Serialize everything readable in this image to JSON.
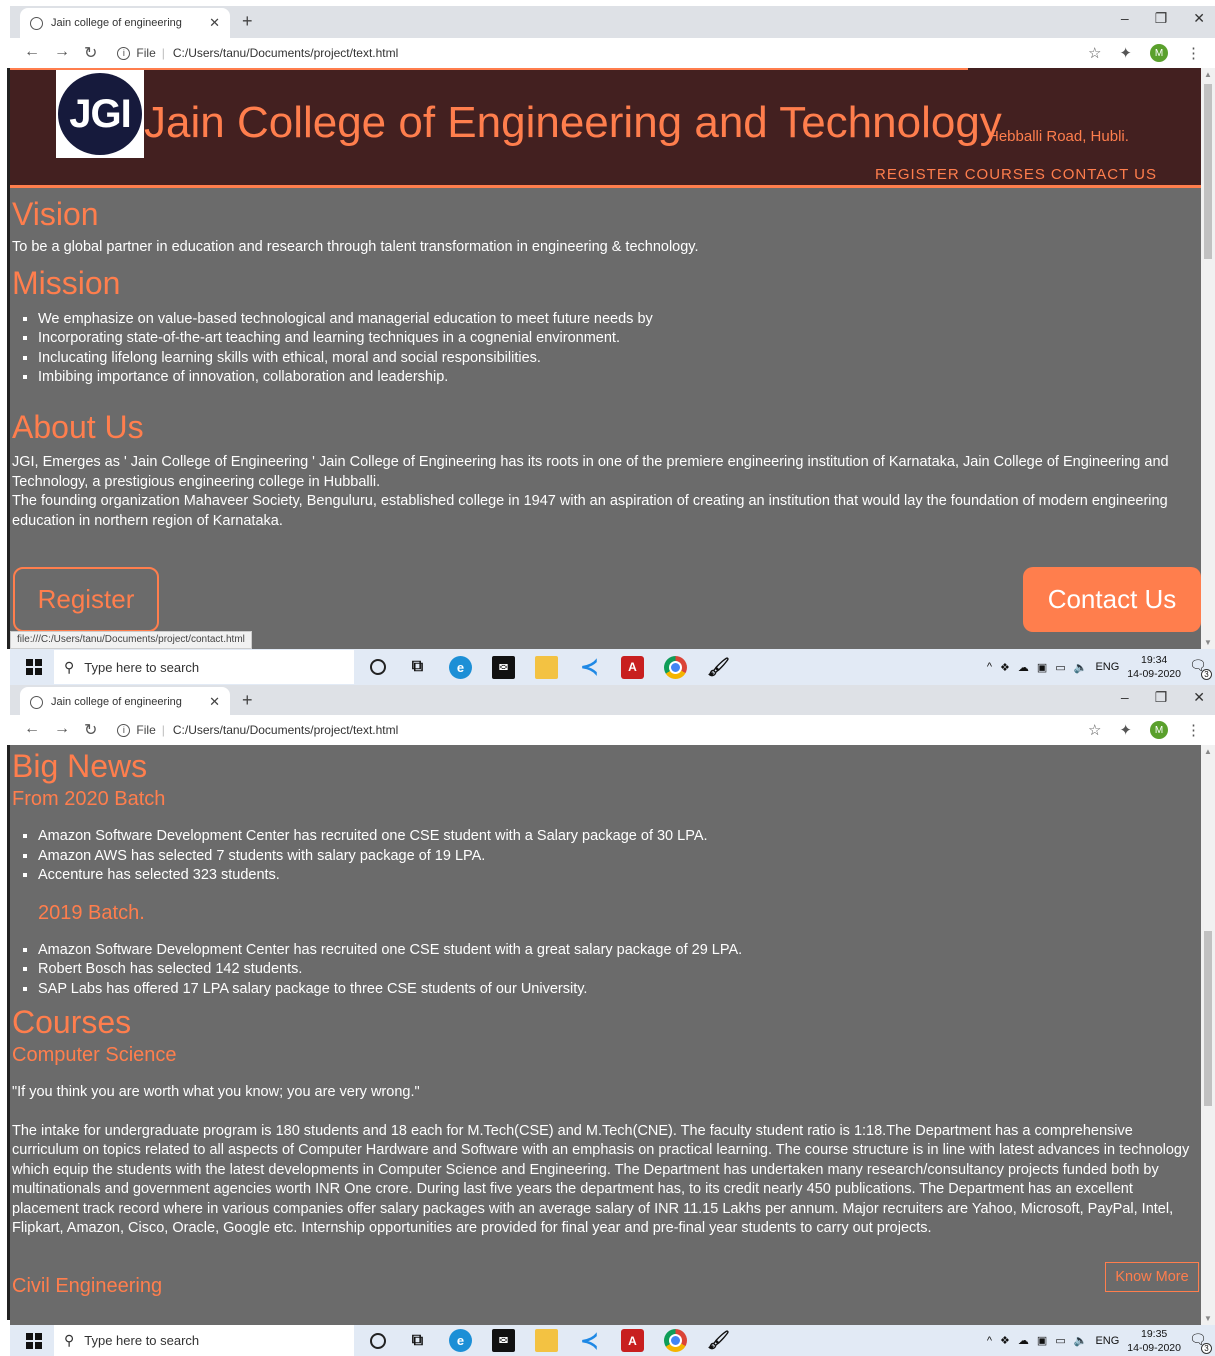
{
  "browser": {
    "tab_title": "Jain college of engineering",
    "tab_close": "✕",
    "new_tab": "+",
    "url_prefix": "File",
    "url": "C:/Users/tanu/Documents/project/text.html",
    "status_url": "file:///C:/Users/tanu/Documents/project/contact.html",
    "profile_initial": "M"
  },
  "site": {
    "college_name": "Jain College of Engineering and Technology",
    "logo_text": "JGI",
    "address": "Hebballi Road, Hubli.",
    "nav": [
      "REGISTER",
      "COURSES",
      "CONTACT US"
    ],
    "vision": {
      "heading": "Vision",
      "text": "To be a global partner in education and research through talent transformation in engineering & technology."
    },
    "mission": {
      "heading": "Mission",
      "items": [
        "We emphasize on value-based technological and managerial education to meet future needs by",
        "Incorporating state-of-the-art teaching and learning techniques in a cognenial environment.",
        "Inclucating lifelong learning skills with ethical, moral and social responsibilities.",
        "Imbibing importance of innovation, collaboration and leadership."
      ]
    },
    "about": {
      "heading": "About Us",
      "para1": "JGI, Emerges as ' Jain College of Engineering ' Jain College of Engineering has its roots in one of the premiere engineering institution of Karnataka, Jain College of Engineering and Technology, a prestigious engineering college in Hubballi.",
      "para2": "The founding organization Mahaveer Society, Benguluru, established college in 1947 with an aspiration of creating an institution that would lay the foundation of modern engineering education in northern region of Karnataka."
    },
    "register_button": "Register",
    "contact_button": "Contact Us",
    "big_news": {
      "heading": "Big News",
      "batch2020": "From 2020 Batch",
      "items2020": [
        "Amazon Software Development Center has recruited one CSE student with a Salary package of 30 LPA.",
        "Amazon AWS has selected 7 students with salary package of 19 LPA.",
        "Accenture has selected 323 students."
      ],
      "batch2019": "2019 Batch.",
      "items2019": [
        "Amazon Software Development Center has recruited one CSE student with a great salary package of 29 LPA.",
        "Robert Bosch has selected 142 students.",
        "SAP Labs has offered 17 LPA salary package to three CSE students of our University."
      ]
    },
    "courses": {
      "heading": "Courses",
      "cs_heading": "Computer Science",
      "quote": "\"If you think you are worth what you know; you are very wrong.\"",
      "cs_text": "The intake for undergraduate program is 180 students and 18 each for M.Tech(CSE) and M.Tech(CNE). The faculty student ratio is 1:18.The Department has a comprehensive curriculum on topics related to all aspects of Computer Hardware and Software with an emphasis on practical learning. The course structure is in line with latest advances in technology which equip the students with the latest developments in Computer Science and Engineering. The Department has undertaken many research/consultancy projects funded both by multinationals and government agencies worth INR One crore. During last five years the department has, to its credit nearly 450 publications. The Department has an excellent placement track record where in various companies offer salary packages with an average salary of INR 11.15 Lakhs per annum. Major recruiters are Yahoo, Microsoft, PayPal, Intel, Flipkart, Amazon, Cisco, Oracle, Google etc. Internship opportunities are provided for final year and pre-final year students to carry out projects.",
      "know_more": "Know More",
      "civil_heading": "Civil Engineering"
    }
  },
  "taskbar": {
    "search_placeholder": "Type here to search",
    "lang": "ENG",
    "time1": "19:34",
    "time2": "19:35",
    "date": "14-09-2020",
    "notifications": "3"
  }
}
